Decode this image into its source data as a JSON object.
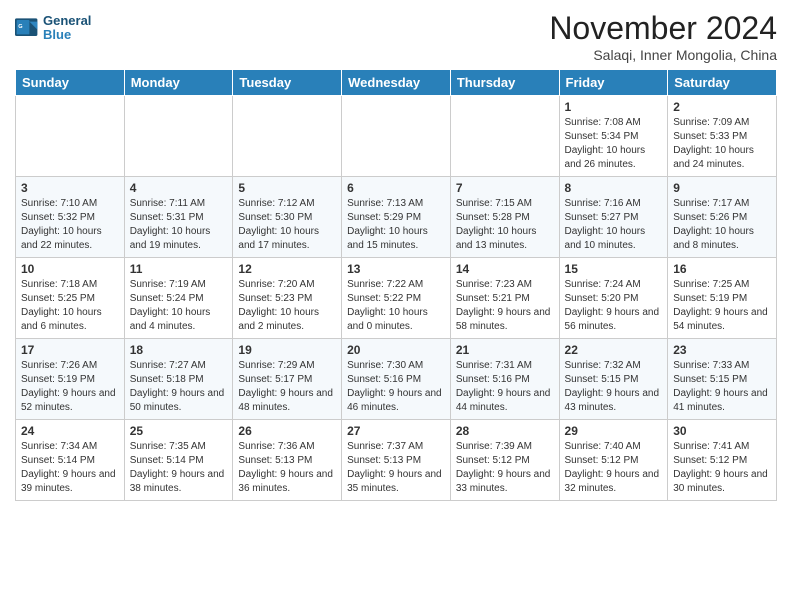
{
  "app": {
    "name": "GeneralBlue",
    "logo_line1": "General",
    "logo_line2": "Blue"
  },
  "calendar": {
    "month": "November 2024",
    "location": "Salaqi, Inner Mongolia, China",
    "day_headers": [
      "Sunday",
      "Monday",
      "Tuesday",
      "Wednesday",
      "Thursday",
      "Friday",
      "Saturday"
    ],
    "weeks": [
      [
        {
          "day": "",
          "detail": ""
        },
        {
          "day": "",
          "detail": ""
        },
        {
          "day": "",
          "detail": ""
        },
        {
          "day": "",
          "detail": ""
        },
        {
          "day": "",
          "detail": ""
        },
        {
          "day": "1",
          "detail": "Sunrise: 7:08 AM\nSunset: 5:34 PM\nDaylight: 10 hours and 26 minutes."
        },
        {
          "day": "2",
          "detail": "Sunrise: 7:09 AM\nSunset: 5:33 PM\nDaylight: 10 hours and 24 minutes."
        }
      ],
      [
        {
          "day": "3",
          "detail": "Sunrise: 7:10 AM\nSunset: 5:32 PM\nDaylight: 10 hours and 22 minutes."
        },
        {
          "day": "4",
          "detail": "Sunrise: 7:11 AM\nSunset: 5:31 PM\nDaylight: 10 hours and 19 minutes."
        },
        {
          "day": "5",
          "detail": "Sunrise: 7:12 AM\nSunset: 5:30 PM\nDaylight: 10 hours and 17 minutes."
        },
        {
          "day": "6",
          "detail": "Sunrise: 7:13 AM\nSunset: 5:29 PM\nDaylight: 10 hours and 15 minutes."
        },
        {
          "day": "7",
          "detail": "Sunrise: 7:15 AM\nSunset: 5:28 PM\nDaylight: 10 hours and 13 minutes."
        },
        {
          "day": "8",
          "detail": "Sunrise: 7:16 AM\nSunset: 5:27 PM\nDaylight: 10 hours and 10 minutes."
        },
        {
          "day": "9",
          "detail": "Sunrise: 7:17 AM\nSunset: 5:26 PM\nDaylight: 10 hours and 8 minutes."
        }
      ],
      [
        {
          "day": "10",
          "detail": "Sunrise: 7:18 AM\nSunset: 5:25 PM\nDaylight: 10 hours and 6 minutes."
        },
        {
          "day": "11",
          "detail": "Sunrise: 7:19 AM\nSunset: 5:24 PM\nDaylight: 10 hours and 4 minutes."
        },
        {
          "day": "12",
          "detail": "Sunrise: 7:20 AM\nSunset: 5:23 PM\nDaylight: 10 hours and 2 minutes."
        },
        {
          "day": "13",
          "detail": "Sunrise: 7:22 AM\nSunset: 5:22 PM\nDaylight: 10 hours and 0 minutes."
        },
        {
          "day": "14",
          "detail": "Sunrise: 7:23 AM\nSunset: 5:21 PM\nDaylight: 9 hours and 58 minutes."
        },
        {
          "day": "15",
          "detail": "Sunrise: 7:24 AM\nSunset: 5:20 PM\nDaylight: 9 hours and 56 minutes."
        },
        {
          "day": "16",
          "detail": "Sunrise: 7:25 AM\nSunset: 5:19 PM\nDaylight: 9 hours and 54 minutes."
        }
      ],
      [
        {
          "day": "17",
          "detail": "Sunrise: 7:26 AM\nSunset: 5:19 PM\nDaylight: 9 hours and 52 minutes."
        },
        {
          "day": "18",
          "detail": "Sunrise: 7:27 AM\nSunset: 5:18 PM\nDaylight: 9 hours and 50 minutes."
        },
        {
          "day": "19",
          "detail": "Sunrise: 7:29 AM\nSunset: 5:17 PM\nDaylight: 9 hours and 48 minutes."
        },
        {
          "day": "20",
          "detail": "Sunrise: 7:30 AM\nSunset: 5:16 PM\nDaylight: 9 hours and 46 minutes."
        },
        {
          "day": "21",
          "detail": "Sunrise: 7:31 AM\nSunset: 5:16 PM\nDaylight: 9 hours and 44 minutes."
        },
        {
          "day": "22",
          "detail": "Sunrise: 7:32 AM\nSunset: 5:15 PM\nDaylight: 9 hours and 43 minutes."
        },
        {
          "day": "23",
          "detail": "Sunrise: 7:33 AM\nSunset: 5:15 PM\nDaylight: 9 hours and 41 minutes."
        }
      ],
      [
        {
          "day": "24",
          "detail": "Sunrise: 7:34 AM\nSunset: 5:14 PM\nDaylight: 9 hours and 39 minutes."
        },
        {
          "day": "25",
          "detail": "Sunrise: 7:35 AM\nSunset: 5:14 PM\nDaylight: 9 hours and 38 minutes."
        },
        {
          "day": "26",
          "detail": "Sunrise: 7:36 AM\nSunset: 5:13 PM\nDaylight: 9 hours and 36 minutes."
        },
        {
          "day": "27",
          "detail": "Sunrise: 7:37 AM\nSunset: 5:13 PM\nDaylight: 9 hours and 35 minutes."
        },
        {
          "day": "28",
          "detail": "Sunrise: 7:39 AM\nSunset: 5:12 PM\nDaylight: 9 hours and 33 minutes."
        },
        {
          "day": "29",
          "detail": "Sunrise: 7:40 AM\nSunset: 5:12 PM\nDaylight: 9 hours and 32 minutes."
        },
        {
          "day": "30",
          "detail": "Sunrise: 7:41 AM\nSunset: 5:12 PM\nDaylight: 9 hours and 30 minutes."
        }
      ]
    ]
  }
}
